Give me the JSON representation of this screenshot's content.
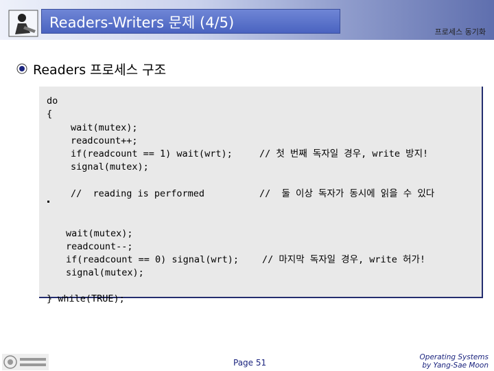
{
  "slide": {
    "title": "Readers-Writers 문제 (4/5)",
    "section": "프로세스 동기화",
    "heading": "Readers 프로세스 구조",
    "code": {
      "line_do": "do",
      "line_open": "{",
      "block1": [
        "wait(mutex);",
        "readcount++;",
        "if(readcount == 1) wait(wrt);",
        "signal(mutex);"
      ],
      "comment1": "// 첫 번째 독자일 경우, write 방지!",
      "reading_line": "//  reading is performed",
      "comment2": "//  둘 이상 독자가 동시에 읽을 수 있다",
      "block2": [
        "wait(mutex);",
        "readcount--;",
        "if(readcount == 0) signal(wrt);",
        "signal(mutex);"
      ],
      "comment3": "// 마지막 독자일 경우, write 허가!",
      "line_close": "} while(TRUE);"
    },
    "page_number": "Page 51",
    "credit_line1": "Operating Systems",
    "credit_line2": "by Yang-Sae Moon"
  },
  "icons": {
    "logo": "person-reading-icon",
    "bullet": "bullet-icon",
    "footer": "university-logo"
  },
  "colors": {
    "title_bar": "#4a63c0",
    "panel_bg": "#e9e9e9",
    "panel_border": "#232d6e",
    "footer_text": "#1a237e"
  }
}
